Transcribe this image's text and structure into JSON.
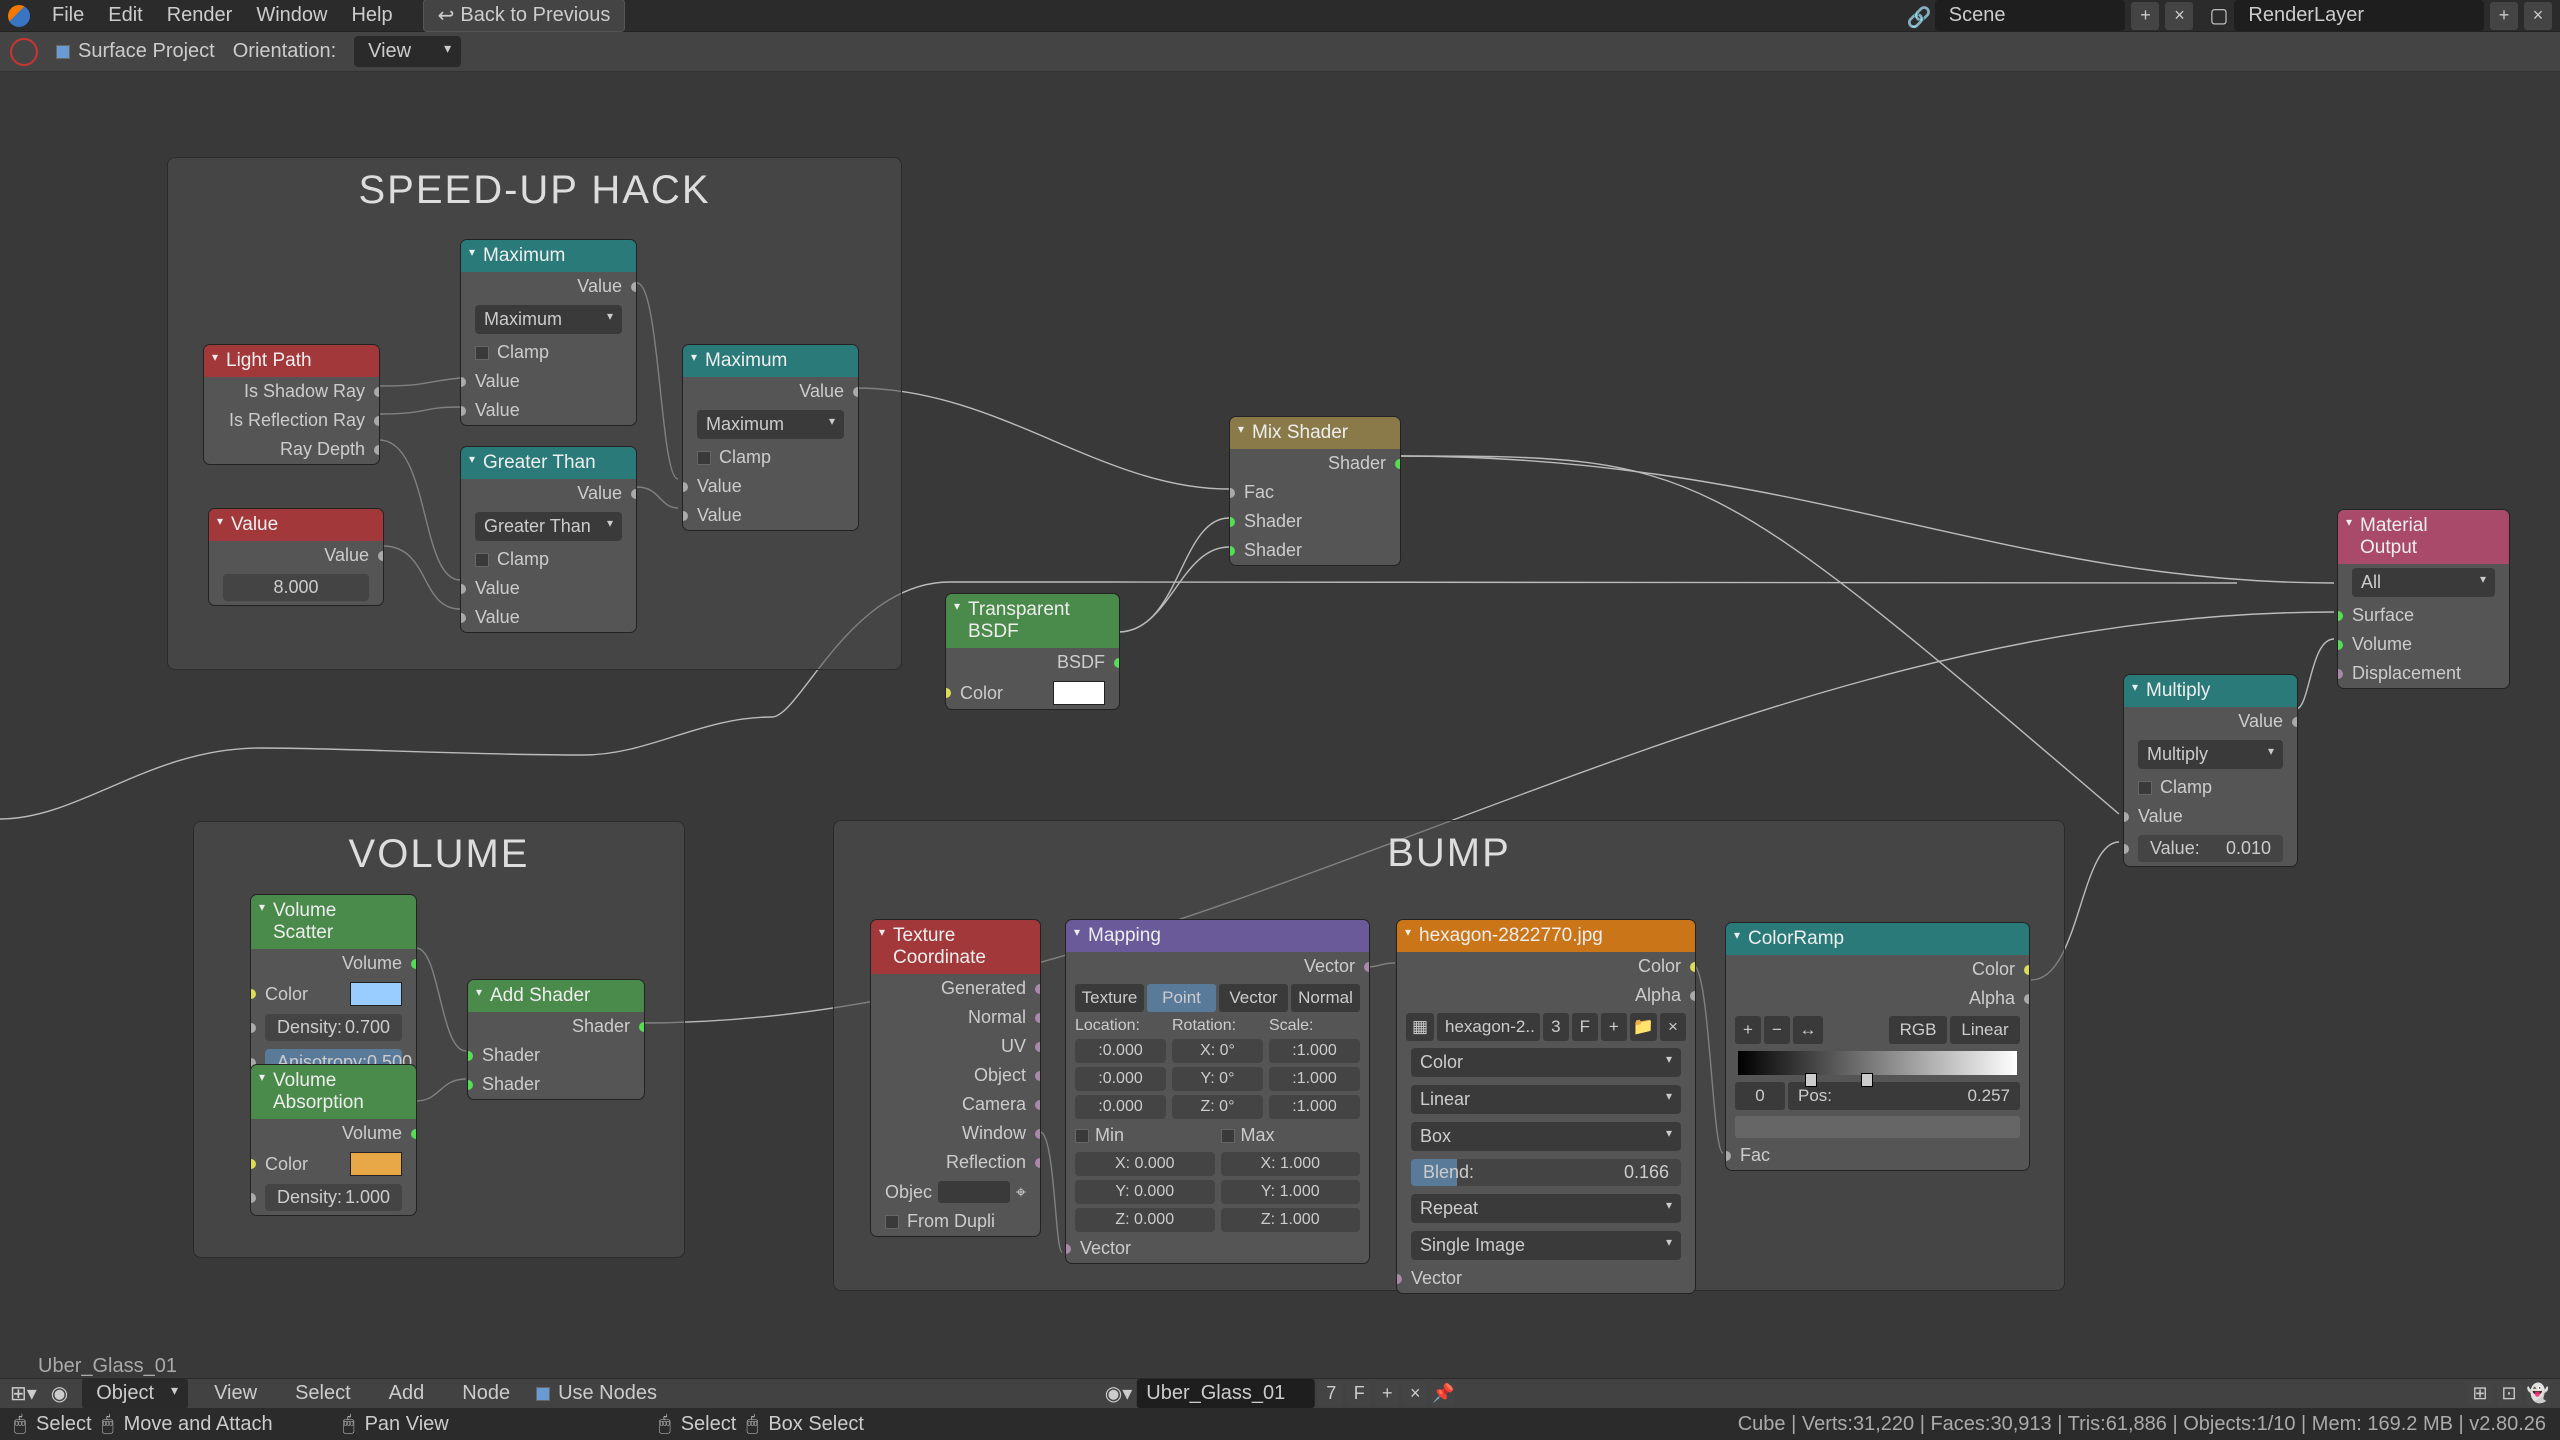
{
  "top": {
    "menus": [
      "File",
      "Edit",
      "Render",
      "Window",
      "Help"
    ],
    "back": "Back to Previous",
    "scene_label": "Scene",
    "layer_label": "RenderLayer"
  },
  "toolbar": {
    "surface_project": "Surface Project",
    "orientation_label": "Orientation:",
    "orientation_value": "View"
  },
  "frames": {
    "speedup": "SPEED-UP HACK",
    "volume": "VOLUME",
    "bump": "BUMP"
  },
  "light_path": {
    "title": "Light Path",
    "o1": "Is Shadow Ray",
    "o2": "Is Reflection Ray",
    "o3": "Ray Depth"
  },
  "value_node": {
    "title": "Value",
    "out": "Value",
    "val": "8.000"
  },
  "max1": {
    "title": "Maximum",
    "out": "Value",
    "mode": "Maximum",
    "clamp": "Clamp",
    "in1": "Value",
    "in2": "Value"
  },
  "gt": {
    "title": "Greater Than",
    "out": "Value",
    "mode": "Greater Than",
    "clamp": "Clamp",
    "in1": "Value",
    "in2": "Value"
  },
  "max2": {
    "title": "Maximum",
    "out": "Value",
    "mode": "Maximum",
    "clamp": "Clamp",
    "in1": "Value",
    "in2": "Value"
  },
  "mix": {
    "title": "Mix Shader",
    "out": "Shader",
    "in1": "Fac",
    "in2": "Shader",
    "in3": "Shader"
  },
  "trans": {
    "title": "Transparent BSDF",
    "out": "BSDF",
    "in": "Color"
  },
  "mout": {
    "title": "Material Output",
    "mode": "All",
    "in1": "Surface",
    "in2": "Volume",
    "in3": "Displacement"
  },
  "mult": {
    "title": "Multiply",
    "out": "Value",
    "mode": "Multiply",
    "clamp": "Clamp",
    "in1": "Value",
    "in2": "Value:",
    "in2val": "0.010"
  },
  "vscat": {
    "title": "Volume Scatter",
    "out": "Volume",
    "c": "Color",
    "d": "Density:",
    "dv": "0.700",
    "a": "Anisotropy:",
    "av": "0.500"
  },
  "vabs": {
    "title": "Volume Absorption",
    "out": "Volume",
    "c": "Color",
    "d": "Density:",
    "dv": "1.000"
  },
  "addsh": {
    "title": "Add Shader",
    "out": "Shader",
    "in1": "Shader",
    "in2": "Shader"
  },
  "texco": {
    "title": "Texture Coordinate",
    "o1": "Generated",
    "o2": "Normal",
    "o3": "UV",
    "o4": "Object",
    "o5": "Camera",
    "o6": "Window",
    "o7": "Reflection",
    "obj": "Objec",
    "dupli": "From Dupli"
  },
  "mapping": {
    "title": "Mapping",
    "out": "Vector",
    "tabs": [
      "Texture",
      "Point",
      "Vector",
      "Normal"
    ],
    "lbl_loc": "Location:",
    "lbl_rot": "Rotation:",
    "lbl_scl": "Scale:",
    "lx": ":0.000",
    "ly": ":0.000",
    "lz": ":0.000",
    "rx": "X:     0°",
    "ry": "Y:     0°",
    "rz": "Z:     0°",
    "sx": ":1.000",
    "sy": ":1.000",
    "sz": ":1.000",
    "min": "Min",
    "max": "Max",
    "minx": "X:      0.000",
    "miny": "Y:      0.000",
    "minz": "Z:      0.000",
    "maxx": "X:      1.000",
    "maxy": "Y:      1.000",
    "maxz": "Z:      1.000",
    "in": "Vector"
  },
  "imgtex": {
    "title": "hexagon-2822770.jpg",
    "o1": "Color",
    "o2": "Alpha",
    "img": "hexagon-2..",
    "users": "3",
    "f": "F",
    "cs": "Color",
    "interp": "Linear",
    "proj": "Box",
    "blend": "Blend:",
    "blendv": "0.166",
    "ext": "Repeat",
    "src": "Single Image",
    "in": "Vector"
  },
  "cramp": {
    "title": "ColorRamp",
    "o1": "Color",
    "o2": "Alpha",
    "mode": "RGB",
    "interp": "Linear",
    "idx": "0",
    "pos_lbl": "Pos:",
    "pos": "0.257",
    "in": "Fac"
  },
  "status": "Uber_Glass_01",
  "btm": {
    "mode": "Object",
    "menus": [
      "View",
      "Select",
      "Add",
      "Node"
    ],
    "use": "Use Nodes",
    "mat": "Uber_Glass_01",
    "matn": "7",
    "f": "F"
  },
  "footer": {
    "select": "Select",
    "move": "Move and Attach",
    "pan": "Pan View",
    "sel2": "Select",
    "box": "Box Select",
    "stats": "Cube | Verts:31,220 | Faces:30,913 | Tris:61,886 | Objects:1/10 | Mem: 169.2 MB | v2.80.26"
  }
}
